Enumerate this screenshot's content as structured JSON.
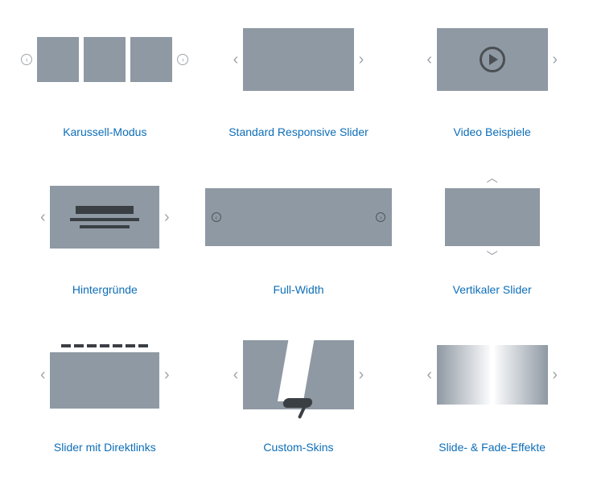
{
  "link_color": "#0d6eb8",
  "box_color": "#8f99a3",
  "items": [
    {
      "label": "Karussell-Modus"
    },
    {
      "label": "Standard Responsive Slider"
    },
    {
      "label": "Video Beispiele"
    },
    {
      "label": "Hintergründe"
    },
    {
      "label": "Full-Width"
    },
    {
      "label": "Vertikaler Slider"
    },
    {
      "label": "Slider mit Direktlinks"
    },
    {
      "label": "Custom-Skins"
    },
    {
      "label": "Slide- & Fade-Effekte"
    }
  ]
}
